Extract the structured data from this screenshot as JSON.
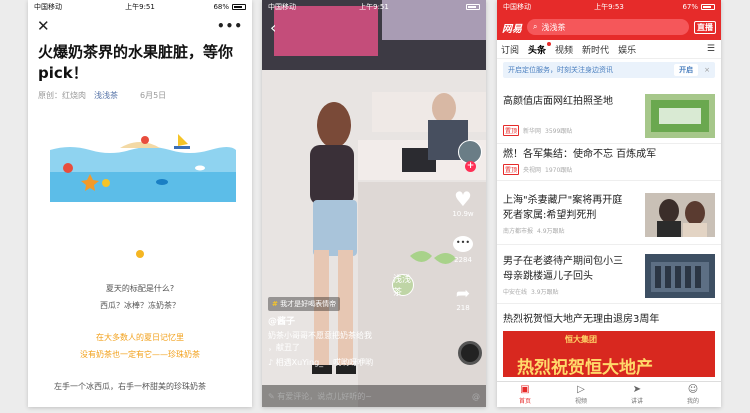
{
  "phone1": {
    "status": {
      "carrier": "中国移动",
      "time": "上午9:51",
      "battery": "68%",
      "battery_level": 0.68
    },
    "nav": {
      "close_icon": "close-icon",
      "more_icon": "more-icon"
    },
    "article": {
      "title_line1": "火爆奶茶界的水果脏脏，等你",
      "title_line2": "pick！",
      "origin_label": "原创：",
      "author": "红烧肉",
      "account": "浅浅茶",
      "date": "6月5日"
    },
    "body": {
      "q1": "夏天的标配是什么?",
      "q2": "西瓜？冰棒？冻奶茶？",
      "h1": "在大多数人的夏日记忆里",
      "h2": "没有奶茶也一定有它——珍珠奶茶",
      "line": "左手一个冰西瓜，右手一杯甜美的珍珠奶茶"
    }
  },
  "phone2": {
    "status": {
      "carrier": "中国移动",
      "time": "上午9:51",
      "battery_level": 0.7
    },
    "likes": "10.9w",
    "comments": "2284",
    "shares": "218",
    "tag_icon": "#",
    "tag": "我才是好喝表情帝",
    "username": "@酱子",
    "desc1": "奶茶小哥哥不愿意把奶茶给我",
    "desc2": "，献丑了",
    "music_prefix": "♪ 相遇XuYing_",
    "music_title": "哎哟呀咿哟",
    "comment_placeholder": "有爱评论，说点儿好听的~",
    "at_icon": "@",
    "neon_sign": "浅浅茶"
  },
  "phone3": {
    "status": {
      "carrier": "中国移动",
      "time": "上午9:53",
      "battery": "67%",
      "battery_level": 0.67
    },
    "logo": "网易",
    "search_text": "浅浅茶",
    "live": "直播",
    "tabs": [
      "订阅",
      "头条",
      "视频",
      "新时代",
      "娱乐"
    ],
    "menu_icon": "☰",
    "position_tip": "开启定位服务，时刻关注身边资讯",
    "position_button": "开启",
    "close_x": "×",
    "news": [
      {
        "title1": "高颜值店面网红拍照圣地",
        "title2": "",
        "tag": "置顶",
        "source": "新华网",
        "count": "3599跟贴"
      },
      {
        "title1": "燃！各军集结：使命不忘 百炼成军",
        "title2": "",
        "tag": "置顶",
        "source": "央视网",
        "count": "1970跟贴"
      },
      {
        "title1": "上海\"杀妻藏尸\"案将再开庭",
        "title2": "死者家属:希望判死刑",
        "tag": "",
        "source": "南方都市报",
        "count": "4.9万跟贴"
      },
      {
        "title1": "男子在老婆待产期间包小三",
        "title2": "母亲跳楼逼儿子回头",
        "tag": "",
        "source": "中安在线",
        "count": "3.9万跟贴"
      },
      {
        "title1": "热烈祝贺恒大地产无理由退房3周年",
        "title2": "",
        "tag": "",
        "source": "",
        "count": ""
      }
    ],
    "banner_brand": "恒大集团",
    "banner_text": "热烈祝贺恒大地产",
    "bottom_nav": [
      {
        "label": "首页",
        "icon": "home-icon"
      },
      {
        "label": "视频",
        "icon": "play-icon"
      },
      {
        "label": "讲讲",
        "icon": "send-icon"
      },
      {
        "label": "我的",
        "icon": "user-icon"
      }
    ]
  }
}
